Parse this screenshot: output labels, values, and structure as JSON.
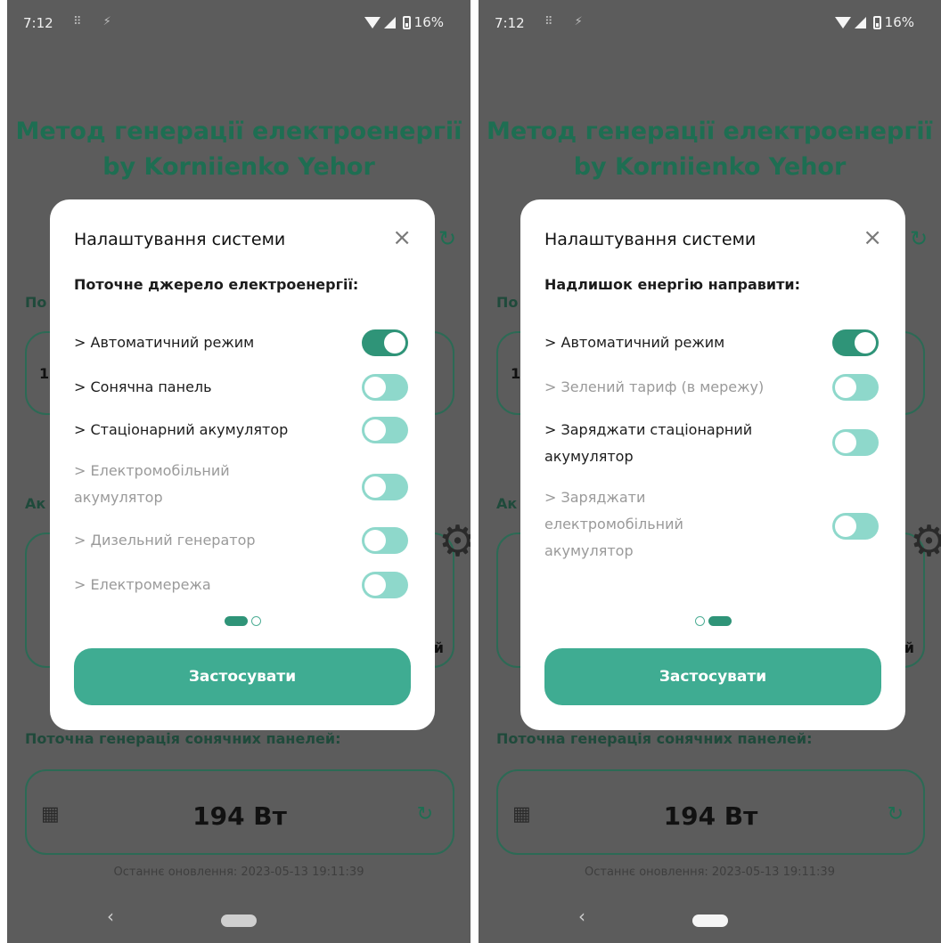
{
  "status": {
    "time": "7:12",
    "notif_icons": "⠿ ⚡",
    "battery": "16%"
  },
  "app": {
    "title_line1": "Метод генерації електроенергії",
    "title_line2": "by Korniienko Yehor",
    "stub_top": "По",
    "stub_mid": "Ак",
    "stub_digit": "1",
    "stub_right": "й",
    "section_solar": "Поточна генерація сонячних панелей:",
    "solar_power": "194 Вт",
    "last_update": "Останнє оновлення: 2023-05-13 19:11:39"
  },
  "dialog_left": {
    "title": "Налаштування системи",
    "close": "×",
    "subtitle": "Поточне джерело електроенергії:",
    "options": [
      {
        "label": "> Автоматичний режим",
        "enabled": true,
        "on": true
      },
      {
        "label": "> Сонячна панель",
        "enabled": true,
        "on": false
      },
      {
        "label": "> Стаціонарний акумулятор",
        "enabled": true,
        "on": false
      },
      {
        "label": "> Електромобільний акумулятор",
        "enabled": false,
        "on": false
      },
      {
        "label": "> Дизельний генератор",
        "enabled": false,
        "on": false
      },
      {
        "label": "> Електромережа",
        "enabled": false,
        "on": false
      }
    ],
    "page": 1,
    "apply": "Застосувати"
  },
  "dialog_right": {
    "title": "Налаштування системи",
    "close": "×",
    "subtitle": "Надлишок енергію направити:",
    "options": [
      {
        "label": "> Автоматичний режим",
        "enabled": true,
        "on": true
      },
      {
        "label": "> Зелений тариф (в мережу)",
        "enabled": false,
        "on": false
      },
      {
        "label": "> Заряджати стаціонарний акумулятор",
        "enabled": true,
        "on": false
      },
      {
        "label": "> Заряджати електромобільний акумулятор",
        "enabled": false,
        "on": false
      }
    ],
    "page": 2,
    "apply": "Застосувати"
  },
  "icons": {
    "close": "close-icon",
    "refresh": "refresh-icon",
    "gear": "gear-icon",
    "solar": "solar-panel-icon"
  },
  "colors": {
    "accent": "#3fac92",
    "toggle_on": "#2f9478",
    "toggle_off": "#8ed8cb",
    "title_green": "#1e6e52"
  }
}
